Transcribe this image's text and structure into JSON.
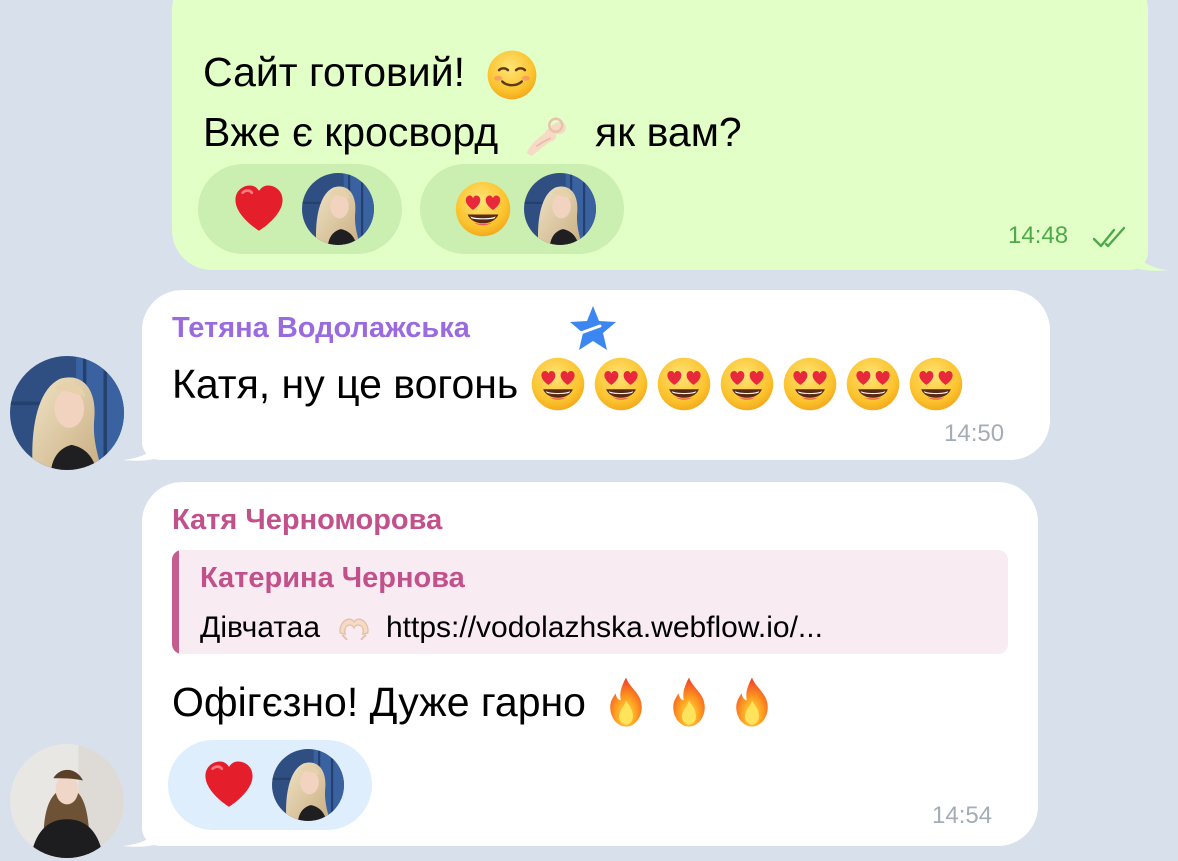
{
  "colors": {
    "background": "#d7e0eb",
    "outgoing_bubble": "#e2ffc8",
    "incoming_bubble": "#ffffff",
    "out_time": "#4fa84a",
    "in_time": "#a4acb5",
    "sender_purple": "#9a6ae0",
    "sender_pink": "#c2508a"
  },
  "messages": {
    "outgoing": {
      "line1": "Сайт готовий!",
      "line1_emoji": "smiling-face-icon",
      "line2_before": "Вже є кросворд",
      "line2_emoji": "ok-hand-icon",
      "line2_after": "як вам?",
      "reactions": [
        {
          "emoji": "red-heart-icon"
        },
        {
          "emoji": "heart-eyes-icon"
        }
      ],
      "time": "14:48",
      "status": "read-double-check-icon"
    },
    "incoming1": {
      "sender": "Тетяна Водолажська",
      "sender_badge": "star-icon",
      "text": "Катя, ну це вогонь",
      "emoji_count": 7,
      "emoji": "heart-eyes-icon",
      "time": "14:50"
    },
    "incoming2": {
      "sender": "Катя Черноморова",
      "reply": {
        "name": "Катерина Чернова",
        "text_before": "Дівчатаа",
        "emoji": "heart-hands-icon",
        "text_after": "https://vodolazhska.webflow.io/..."
      },
      "text": "Офігєзно! Дуже гарно",
      "emoji_count": 3,
      "emoji": "fire-icon",
      "reactions": [
        {
          "emoji": "red-heart-icon"
        }
      ],
      "time": "14:54"
    }
  }
}
